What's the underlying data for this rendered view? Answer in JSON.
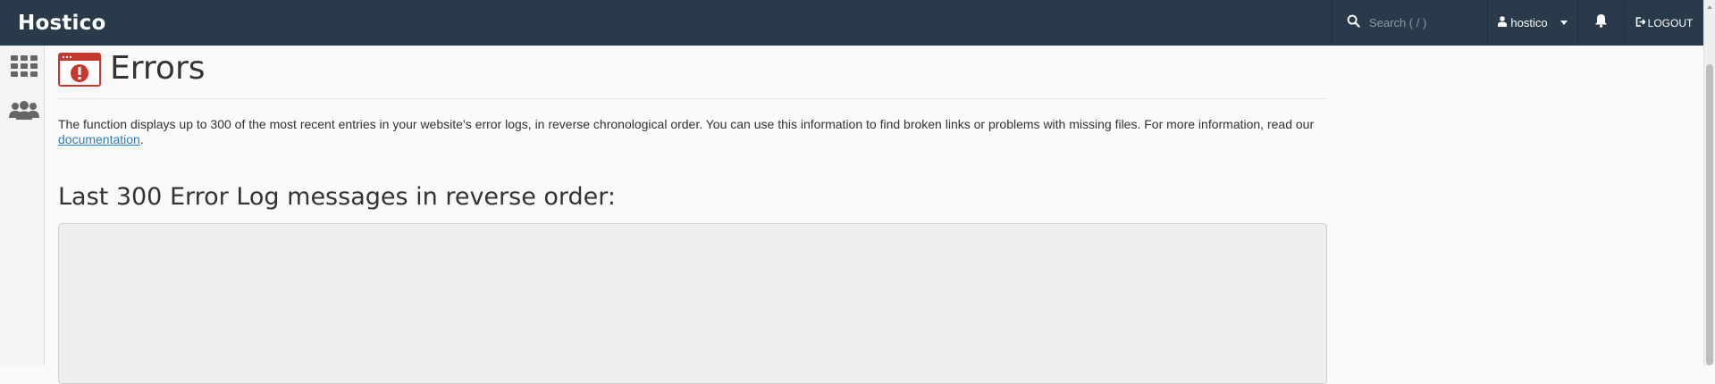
{
  "header": {
    "brand": "Hostico",
    "search_placeholder": "Search ( / )",
    "username": "hostico",
    "logout_label": "LOGOUT"
  },
  "sidebar": {
    "items": [
      {
        "icon": "grid-icon"
      },
      {
        "icon": "users-icon"
      }
    ]
  },
  "page": {
    "title": "Errors",
    "description_text": "The function displays up to 300 of the most recent entries in your website’s error logs, in reverse chronological order. You can use this information to find broken links or problems with missing files. For more information, read our ",
    "description_link": "documentation",
    "description_end": ".",
    "section_title": "Last 300 Error Log messages in reverse order:",
    "log_content": ""
  },
  "colors": {
    "topbar": "#293a4a",
    "accent_red": "#c8372d",
    "link": "#2f7db8"
  }
}
